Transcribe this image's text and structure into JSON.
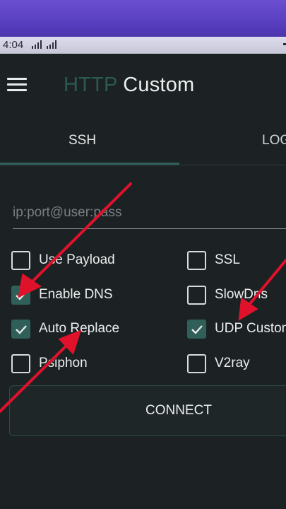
{
  "status_bar": {
    "time": "4:04"
  },
  "app_bar": {
    "title_part1": "HTTP",
    "title_part2": "Custom"
  },
  "tabs": [
    {
      "label": "SSH",
      "active": true
    },
    {
      "label": "LOG",
      "active": false
    }
  ],
  "server_field": {
    "placeholder": "ip:port@user:pass",
    "value": ""
  },
  "options": {
    "left": [
      {
        "label": "Use Payload",
        "checked": false
      },
      {
        "label": "Enable DNS",
        "checked": true
      },
      {
        "label": "Auto Replace",
        "checked": true
      },
      {
        "label": "Psiphon",
        "checked": false
      }
    ],
    "right": [
      {
        "label": "SSL",
        "checked": false
      },
      {
        "label": "SlowDns",
        "checked": false
      },
      {
        "label": "UDP Custom",
        "checked": true
      },
      {
        "label": "V2ray",
        "checked": false
      }
    ]
  },
  "connect_button": {
    "label": "CONNECT"
  },
  "colors": {
    "background": "#1c2224",
    "accent": "#2f5f58",
    "title_dim": "#2c5951",
    "annotation_arrow": "#e0122b"
  }
}
